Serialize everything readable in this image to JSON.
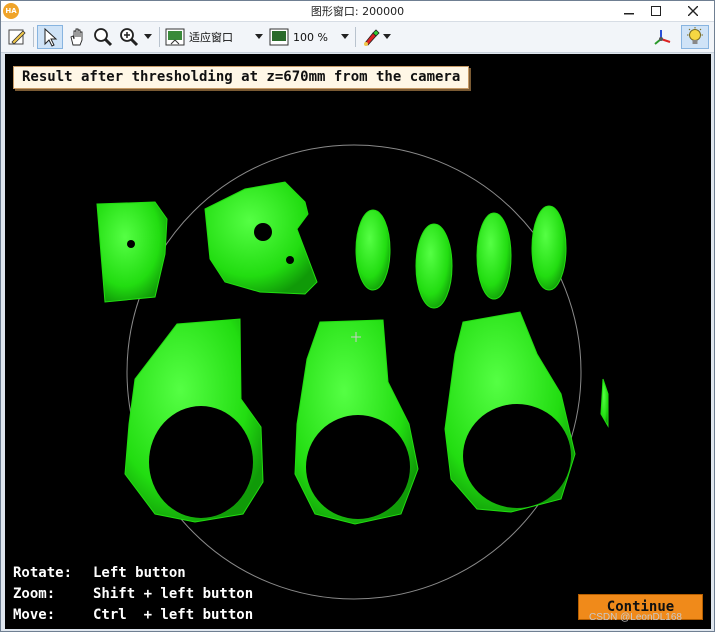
{
  "window": {
    "logo": "HA",
    "title": "图形窗口: 200000",
    "minimize_icon": "minimize-icon",
    "maximize_icon": "maximize-icon",
    "close_icon": "close-icon"
  },
  "toolbar": {
    "icons": [
      "pencil-icon",
      "pointer-icon",
      "hand-icon",
      "magnifier-icon",
      "zoom-in-icon",
      "fit-window-icon",
      "zoom-percent-icon",
      "paint-icon",
      "axes-icon",
      "lightbulb-icon"
    ],
    "fit_label": "适应窗口",
    "zoom_value": "100 %"
  },
  "viewport": {
    "banner": "Result after thresholding at z=670mm from the camera",
    "help": {
      "rotate_key": "Rotate:",
      "rotate_val": "Left button",
      "zoom_key": "Zoom:",
      "zoom_val": "Shift + left button",
      "move_key": "Move:",
      "move_val": "Ctrl  + left button"
    },
    "continue_label": "Continue",
    "watermark": "CSDN @LeonDL168",
    "colors": {
      "object": "#22dd11",
      "background": "#000000",
      "circle": "#8a8a8a"
    }
  }
}
